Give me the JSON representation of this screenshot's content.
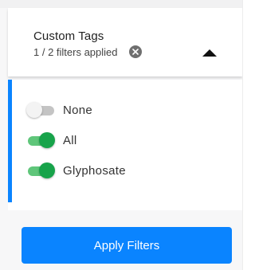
{
  "colors": {
    "accent": "#0a84ff",
    "toggle_on": "#17a34a",
    "toggle_off": "#c4c4c4",
    "clear_icon": "#6f6f6f"
  },
  "section": {
    "title": "Custom Tags",
    "subtitle": "1 / 2 filters applied",
    "clear_icon": "close-circle-icon",
    "collapse_icon": "triangle-up-icon"
  },
  "options": [
    {
      "label": "None",
      "enabled": false
    },
    {
      "label": "All",
      "enabled": true
    },
    {
      "label": "Glyphosate",
      "enabled": true
    }
  ],
  "apply_button": {
    "label": "Apply Filters"
  }
}
